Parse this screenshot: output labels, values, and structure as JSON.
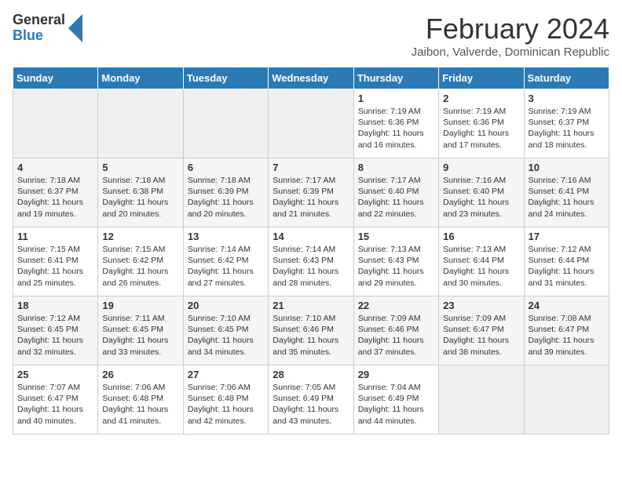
{
  "logo": {
    "general": "General",
    "blue": "Blue"
  },
  "title": "February 2024",
  "subtitle": "Jaibon, Valverde, Dominican Republic",
  "days_of_week": [
    "Sunday",
    "Monday",
    "Tuesday",
    "Wednesday",
    "Thursday",
    "Friday",
    "Saturday"
  ],
  "weeks": [
    [
      {
        "day": "",
        "info": ""
      },
      {
        "day": "",
        "info": ""
      },
      {
        "day": "",
        "info": ""
      },
      {
        "day": "",
        "info": ""
      },
      {
        "day": "1",
        "info": "Sunrise: 7:19 AM\nSunset: 6:36 PM\nDaylight: 11 hours and 16 minutes."
      },
      {
        "day": "2",
        "info": "Sunrise: 7:19 AM\nSunset: 6:36 PM\nDaylight: 11 hours and 17 minutes."
      },
      {
        "day": "3",
        "info": "Sunrise: 7:19 AM\nSunset: 6:37 PM\nDaylight: 11 hours and 18 minutes."
      }
    ],
    [
      {
        "day": "4",
        "info": "Sunrise: 7:18 AM\nSunset: 6:37 PM\nDaylight: 11 hours and 19 minutes."
      },
      {
        "day": "5",
        "info": "Sunrise: 7:18 AM\nSunset: 6:38 PM\nDaylight: 11 hours and 20 minutes."
      },
      {
        "day": "6",
        "info": "Sunrise: 7:18 AM\nSunset: 6:39 PM\nDaylight: 11 hours and 20 minutes."
      },
      {
        "day": "7",
        "info": "Sunrise: 7:17 AM\nSunset: 6:39 PM\nDaylight: 11 hours and 21 minutes."
      },
      {
        "day": "8",
        "info": "Sunrise: 7:17 AM\nSunset: 6:40 PM\nDaylight: 11 hours and 22 minutes."
      },
      {
        "day": "9",
        "info": "Sunrise: 7:16 AM\nSunset: 6:40 PM\nDaylight: 11 hours and 23 minutes."
      },
      {
        "day": "10",
        "info": "Sunrise: 7:16 AM\nSunset: 6:41 PM\nDaylight: 11 hours and 24 minutes."
      }
    ],
    [
      {
        "day": "11",
        "info": "Sunrise: 7:15 AM\nSunset: 6:41 PM\nDaylight: 11 hours and 25 minutes."
      },
      {
        "day": "12",
        "info": "Sunrise: 7:15 AM\nSunset: 6:42 PM\nDaylight: 11 hours and 26 minutes."
      },
      {
        "day": "13",
        "info": "Sunrise: 7:14 AM\nSunset: 6:42 PM\nDaylight: 11 hours and 27 minutes."
      },
      {
        "day": "14",
        "info": "Sunrise: 7:14 AM\nSunset: 6:43 PM\nDaylight: 11 hours and 28 minutes."
      },
      {
        "day": "15",
        "info": "Sunrise: 7:13 AM\nSunset: 6:43 PM\nDaylight: 11 hours and 29 minutes."
      },
      {
        "day": "16",
        "info": "Sunrise: 7:13 AM\nSunset: 6:44 PM\nDaylight: 11 hours and 30 minutes."
      },
      {
        "day": "17",
        "info": "Sunrise: 7:12 AM\nSunset: 6:44 PM\nDaylight: 11 hours and 31 minutes."
      }
    ],
    [
      {
        "day": "18",
        "info": "Sunrise: 7:12 AM\nSunset: 6:45 PM\nDaylight: 11 hours and 32 minutes."
      },
      {
        "day": "19",
        "info": "Sunrise: 7:11 AM\nSunset: 6:45 PM\nDaylight: 11 hours and 33 minutes."
      },
      {
        "day": "20",
        "info": "Sunrise: 7:10 AM\nSunset: 6:45 PM\nDaylight: 11 hours and 34 minutes."
      },
      {
        "day": "21",
        "info": "Sunrise: 7:10 AM\nSunset: 6:46 PM\nDaylight: 11 hours and 35 minutes."
      },
      {
        "day": "22",
        "info": "Sunrise: 7:09 AM\nSunset: 6:46 PM\nDaylight: 11 hours and 37 minutes."
      },
      {
        "day": "23",
        "info": "Sunrise: 7:09 AM\nSunset: 6:47 PM\nDaylight: 11 hours and 38 minutes."
      },
      {
        "day": "24",
        "info": "Sunrise: 7:08 AM\nSunset: 6:47 PM\nDaylight: 11 hours and 39 minutes."
      }
    ],
    [
      {
        "day": "25",
        "info": "Sunrise: 7:07 AM\nSunset: 6:47 PM\nDaylight: 11 hours and 40 minutes."
      },
      {
        "day": "26",
        "info": "Sunrise: 7:06 AM\nSunset: 6:48 PM\nDaylight: 11 hours and 41 minutes."
      },
      {
        "day": "27",
        "info": "Sunrise: 7:06 AM\nSunset: 6:48 PM\nDaylight: 11 hours and 42 minutes."
      },
      {
        "day": "28",
        "info": "Sunrise: 7:05 AM\nSunset: 6:49 PM\nDaylight: 11 hours and 43 minutes."
      },
      {
        "day": "29",
        "info": "Sunrise: 7:04 AM\nSunset: 6:49 PM\nDaylight: 11 hours and 44 minutes."
      },
      {
        "day": "",
        "info": ""
      },
      {
        "day": "",
        "info": ""
      }
    ]
  ]
}
